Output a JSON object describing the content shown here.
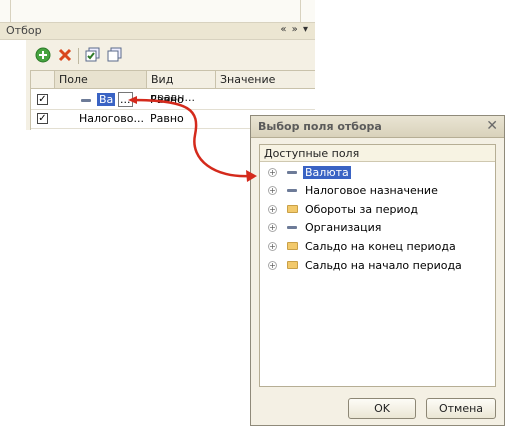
{
  "filter_panel": {
    "title": "Отбор",
    "header_controls": "« » ▾",
    "columns": [
      "Поле",
      "Вид сравн...",
      "Значение"
    ],
    "rows": [
      {
        "checked": true,
        "field": "Ва",
        "field_suffix": "...",
        "comparison": "Равно",
        "value": ""
      },
      {
        "checked": true,
        "field": "Налогово...",
        "comparison": "Равно",
        "value": ""
      }
    ]
  },
  "dialog": {
    "title": "Выбор поля отбора",
    "list_header": "Доступные поля",
    "items": [
      {
        "label": "Валюта",
        "icon": "attribute-icon",
        "selected": true
      },
      {
        "label": "Налоговое назначение",
        "icon": "attribute-icon"
      },
      {
        "label": "Обороты за период",
        "icon": "folder-icon"
      },
      {
        "label": "Организация",
        "icon": "attribute-icon"
      },
      {
        "label": "Сальдо на конец периода",
        "icon": "folder-icon"
      },
      {
        "label": "Сальдо на начало периода",
        "icon": "folder-icon"
      }
    ],
    "ok_label": "OK",
    "cancel_label": "Отмена"
  },
  "colors": {
    "selection": "#3a63c4",
    "annotation_arrow": "#d42a1c",
    "panel_bg": "#f4f0e4"
  }
}
